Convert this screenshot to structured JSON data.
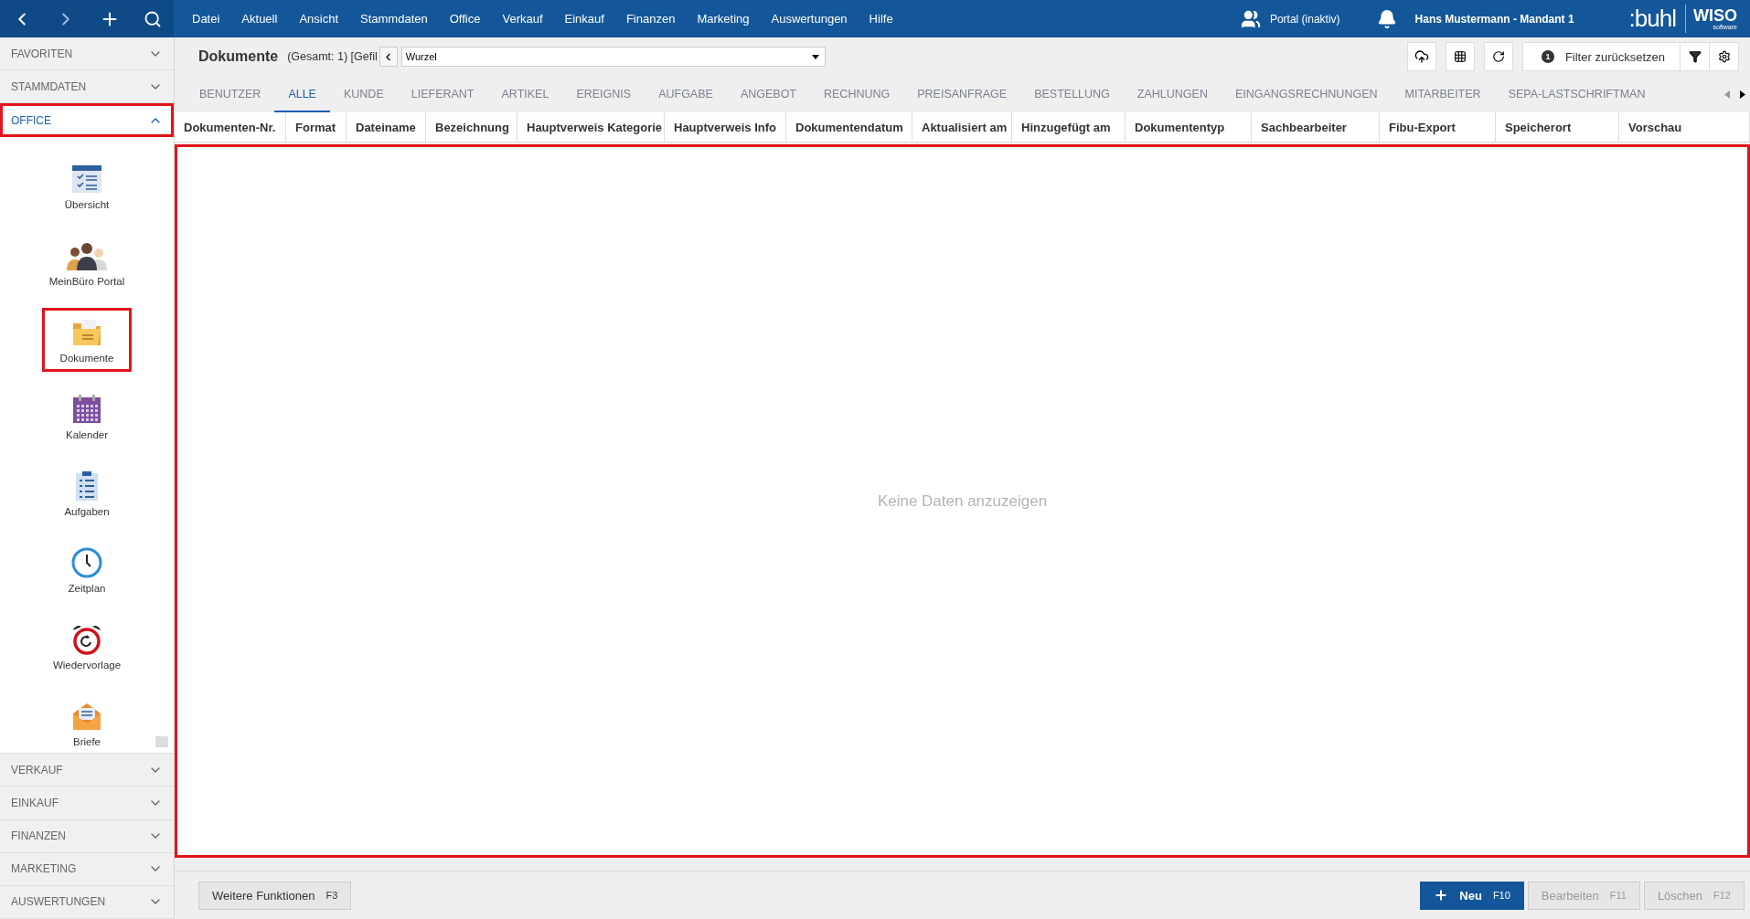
{
  "top_bar": {
    "menu": [
      "Datei",
      "Aktuell",
      "Ansicht",
      "Stammdaten",
      "Office",
      "Verkauf",
      "Einkauf",
      "Finanzen",
      "Marketing",
      "Auswertungen",
      "Hilfe"
    ],
    "portal": "Portal (inaktiv)",
    "user": "Hans Mustermann - Mandant 1",
    "logo_left": ":buhl",
    "logo_right": "WISO",
    "logo_sub": "software"
  },
  "sidebar": {
    "sections_top": [
      {
        "label": "FAVORITEN",
        "expanded": false,
        "highlighted": false
      },
      {
        "label": "STAMMDATEN",
        "expanded": false,
        "highlighted": false
      },
      {
        "label": "OFFICE",
        "expanded": true,
        "highlighted": true
      }
    ],
    "items": [
      {
        "label": "Übersicht",
        "kind": "overview",
        "highlighted": false
      },
      {
        "label": "MeinBüro Portal",
        "kind": "people",
        "highlighted": false
      },
      {
        "label": "Dokumente",
        "kind": "folder",
        "highlighted": true
      },
      {
        "label": "Kalender",
        "kind": "calendar",
        "highlighted": false
      },
      {
        "label": "Aufgaben",
        "kind": "tasks",
        "highlighted": false
      },
      {
        "label": "Zeitplan",
        "kind": "clock",
        "highlighted": false
      },
      {
        "label": "Wiedervorlage",
        "kind": "alarm",
        "highlighted": false
      },
      {
        "label": "Briefe",
        "kind": "letter",
        "highlighted": false
      }
    ],
    "sections_bottom": [
      {
        "label": "VERKAUF",
        "expanded": false,
        "highlighted": false
      },
      {
        "label": "EINKAUF",
        "expanded": false,
        "highlighted": false
      },
      {
        "label": "FINANZEN",
        "expanded": false,
        "highlighted": false
      },
      {
        "label": "MARKETING",
        "expanded": false,
        "highlighted": false
      },
      {
        "label": "AUSWERTUNGEN",
        "expanded": false,
        "highlighted": false
      }
    ]
  },
  "header": {
    "title": "Dokumente",
    "info": "(Gesamt: 1) [Gefil",
    "folder": "Wurzel",
    "filter_count": "1",
    "filter_reset": "Filter zurücksetzen"
  },
  "tabs": [
    {
      "label": "BENUTZER",
      "selected": false
    },
    {
      "label": "ALLE",
      "selected": true
    },
    {
      "label": "KUNDE",
      "selected": false
    },
    {
      "label": "LIEFERANT",
      "selected": false
    },
    {
      "label": "ARTIKEL",
      "selected": false
    },
    {
      "label": "EREIGNIS",
      "selected": false
    },
    {
      "label": "AUFGABE",
      "selected": false
    },
    {
      "label": "ANGEBOT",
      "selected": false
    },
    {
      "label": "RECHNUNG",
      "selected": false
    },
    {
      "label": "PREISANFRAGE",
      "selected": false
    },
    {
      "label": "BESTELLUNG",
      "selected": false
    },
    {
      "label": "ZAHLUNGEN",
      "selected": false
    },
    {
      "label": "EINGANGSRECHNUNGEN",
      "selected": false
    },
    {
      "label": "MITARBEITER",
      "selected": false
    },
    {
      "label": "SEPA-LASTSCHRIFTMAN",
      "selected": false
    }
  ],
  "table": {
    "columns": [
      "Dokumenten-Nr.",
      "Format",
      "Dateiname",
      "Bezeichnung",
      "Hauptverweis Kategorie",
      "Hauptverweis Info",
      "Dokumentendatum",
      "Aktualisiert am",
      "Hinzugefügt am",
      "Dokumententyp",
      "Sachbearbeiter",
      "Fibu-Export",
      "Speicherort",
      "Vorschau"
    ],
    "empty_message": "Keine Daten anzuzeigen",
    "highlighted": true
  },
  "footer": {
    "more": {
      "label": "Weitere Funktionen",
      "key": "F3"
    },
    "actions": [
      {
        "label": "Neu",
        "key": "F10",
        "disabled": false,
        "kind": "primary"
      },
      {
        "label": "Bearbeiten",
        "key": "F11",
        "disabled": true,
        "kind": "plain"
      },
      {
        "label": "Löschen",
        "key": "F12",
        "disabled": true,
        "kind": "plain"
      }
    ]
  }
}
